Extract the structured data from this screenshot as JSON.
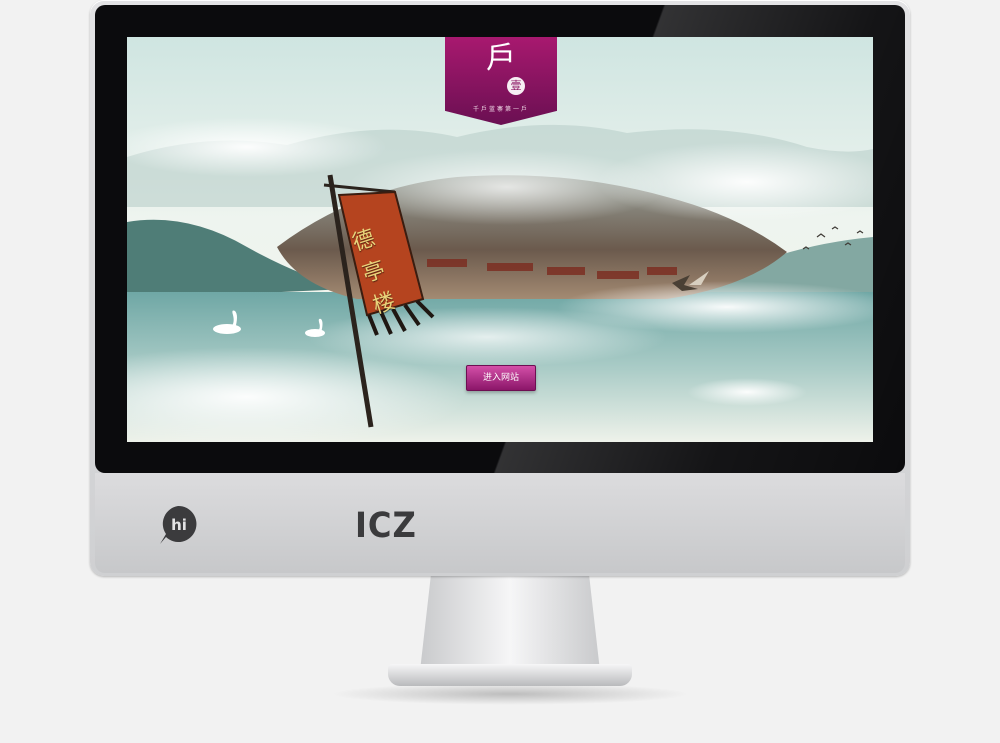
{
  "brand": {
    "logo_text": "ICZ",
    "bubble_text": "hi"
  },
  "site": {
    "logo_glyph": "戶",
    "logo_seal": "壹",
    "slogan": "千戶蓝寨第一戶",
    "enter_button_label": "进入网站",
    "banner_chars": [
      "德",
      "亭",
      "楼"
    ]
  },
  "colors": {
    "accent": "#8b1669",
    "banner": "#b5441f",
    "water": "#7fb2ae",
    "bezel": "#0b0b0d"
  }
}
